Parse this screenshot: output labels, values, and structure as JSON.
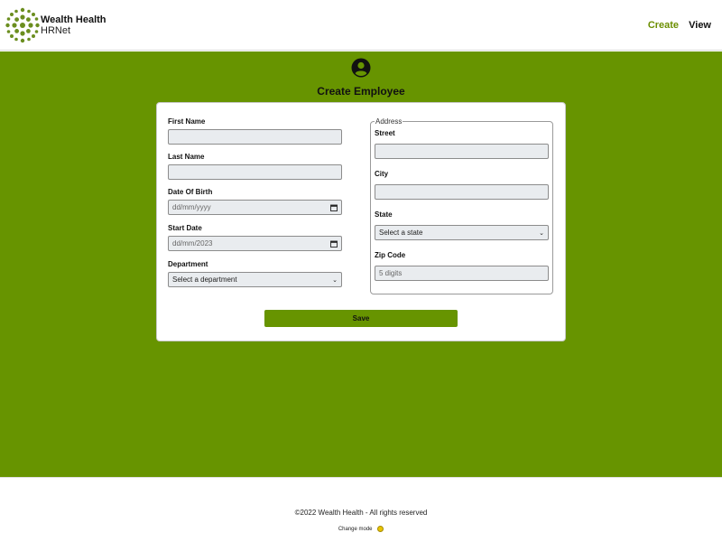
{
  "header": {
    "brand_title": "Wealth Health",
    "brand_subtitle": "HRNet",
    "nav": {
      "create": "Create",
      "view": "View"
    },
    "logo_icon": "sunburst-leaf-logo",
    "colors": {
      "accent": "#6b8e00"
    }
  },
  "main": {
    "background_color": "#679400",
    "icon": "user-circle-icon",
    "title": "Create Employee"
  },
  "form": {
    "first_name": {
      "label": "First Name",
      "value": ""
    },
    "last_name": {
      "label": "Last Name",
      "value": ""
    },
    "date_of_birth": {
      "label": "Date Of Birth",
      "placeholder": "dd/mm/yyyy"
    },
    "start_date": {
      "label": "Start Date",
      "placeholder": "dd/mm/2023"
    },
    "department": {
      "label": "Department",
      "selected": "Select a department"
    },
    "address": {
      "legend": "Address",
      "street": {
        "label": "Street",
        "value": ""
      },
      "city": {
        "label": "City",
        "value": ""
      },
      "state": {
        "label": "State",
        "selected": "Select a state"
      },
      "zip": {
        "label": "Zip Code",
        "placeholder": "5 digits"
      }
    },
    "save_label": "Save"
  },
  "footer": {
    "copyright": "©2022 Wealth Health - All rights reserved",
    "change_mode": "Change mode"
  }
}
